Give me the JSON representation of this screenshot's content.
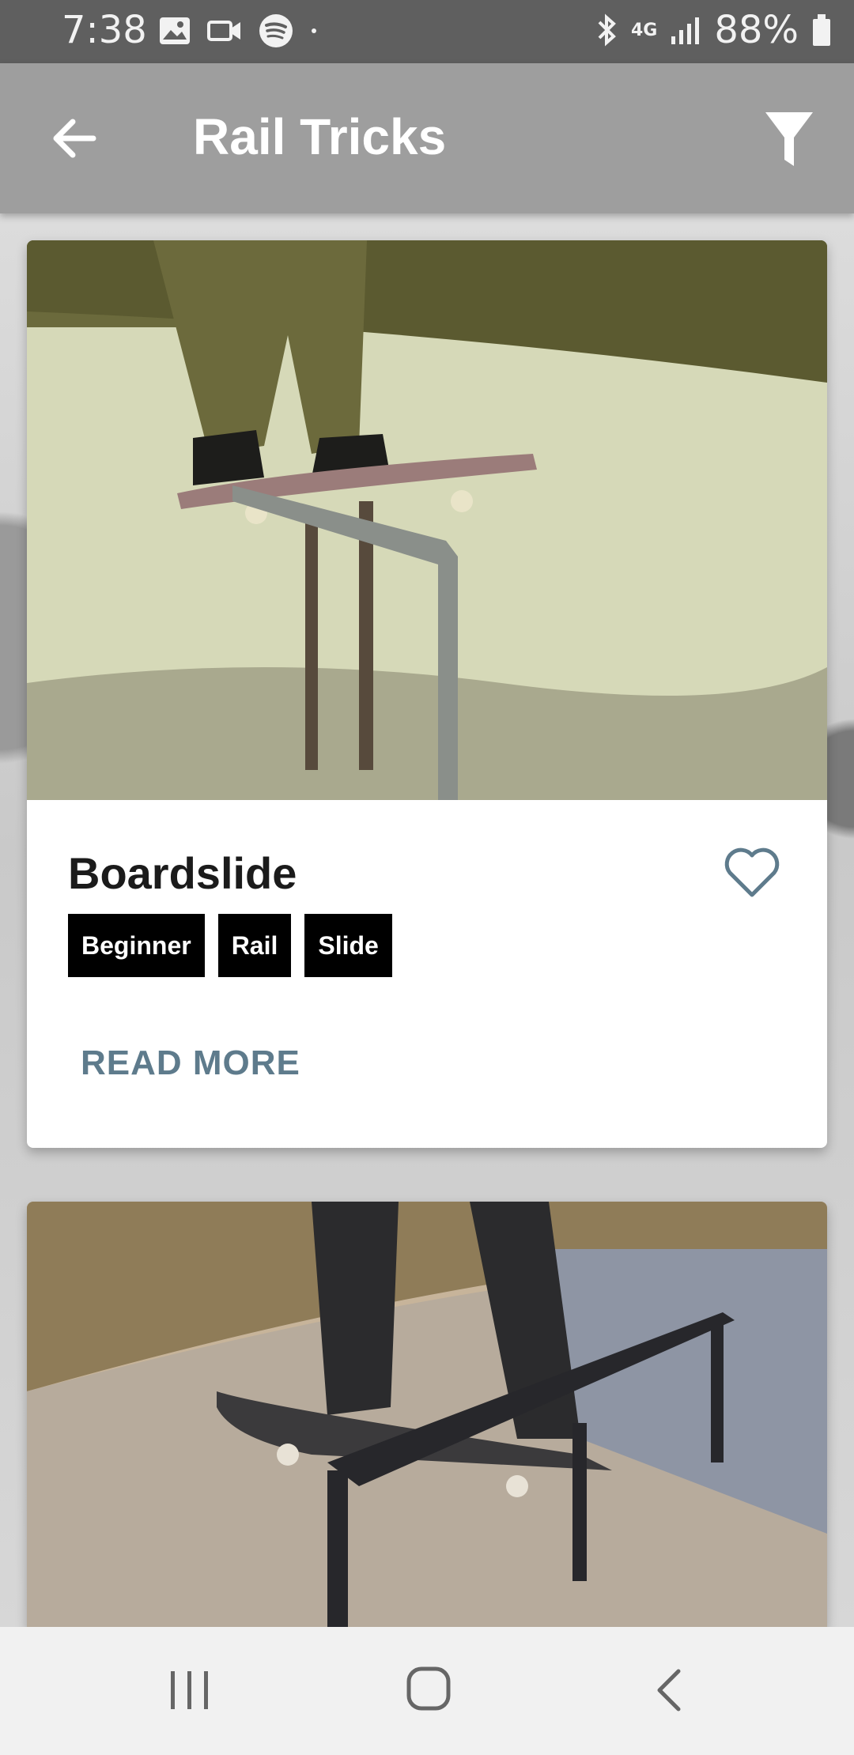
{
  "status_bar": {
    "time": "7:38",
    "battery": "88%",
    "network": "4G"
  },
  "app_bar": {
    "title": "Rail Tricks"
  },
  "cards": [
    {
      "title": "Boardslide",
      "tags": [
        "Beginner",
        "Rail",
        "Slide"
      ],
      "action": "READ MORE"
    }
  ],
  "colors": {
    "status_bar": "#5f5f5f",
    "app_bar": "#9e9e9e",
    "tag_bg": "#000000",
    "accent": "#5e7b8c"
  },
  "icons": {
    "back": "arrow-left-icon",
    "filter": "filter-icon",
    "favorite": "heart-outline-icon",
    "nav_recents": "recents-icon",
    "nav_home": "home-icon",
    "nav_back": "chevron-left-icon"
  }
}
